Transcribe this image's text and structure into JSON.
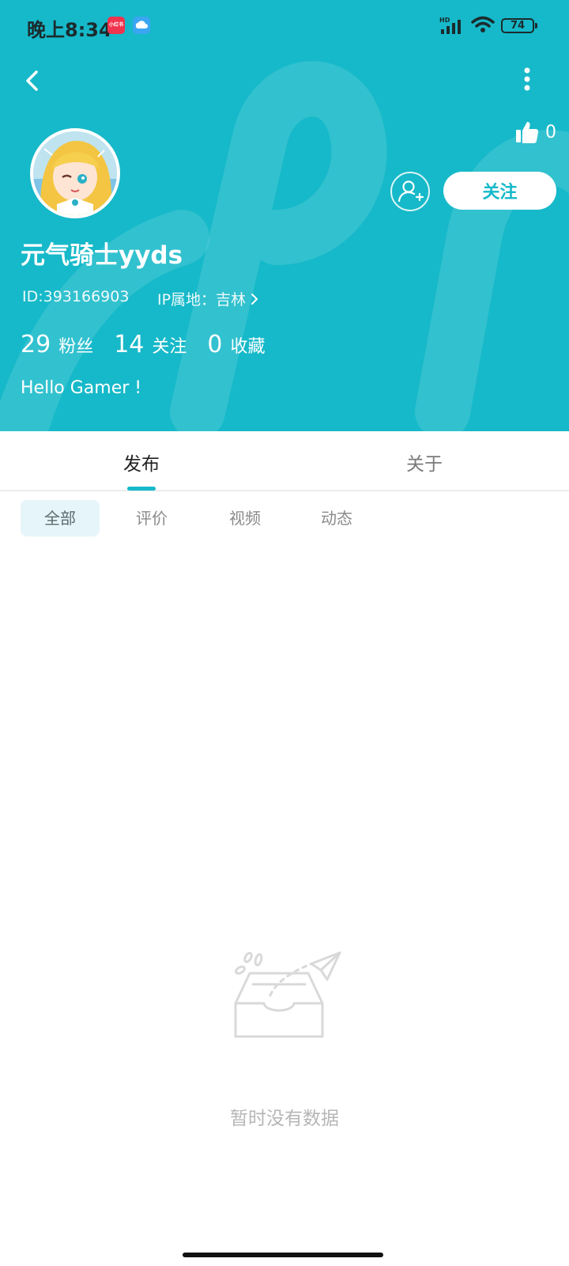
{
  "status_bar": {
    "time": "晚上8:34",
    "app_badge_text": "小红书",
    "network_label": "HD",
    "battery": "74"
  },
  "header": {
    "background_color": "#16b9c9",
    "like_count": "0",
    "follow_label": "关注",
    "username": "元气骑士yyds",
    "id_text": "ID:393166903",
    "ip_text": "IP属地：吉林",
    "stats": [
      {
        "value": "29",
        "label": "粉丝"
      },
      {
        "value": "14",
        "label": "关注"
      },
      {
        "value": "0",
        "label": "收藏"
      }
    ],
    "bio": "Hello Gamer !"
  },
  "tabs": {
    "items": [
      {
        "label": "发布",
        "active": true
      },
      {
        "label": "关于",
        "active": false
      }
    ],
    "accent_color": "#16b9c9"
  },
  "filters": {
    "items": [
      {
        "label": "全部",
        "active": true
      },
      {
        "label": "评价",
        "active": false
      },
      {
        "label": "视频",
        "active": false
      },
      {
        "label": "动态",
        "active": false
      }
    ]
  },
  "empty_state": {
    "message": "暂时没有数据"
  }
}
